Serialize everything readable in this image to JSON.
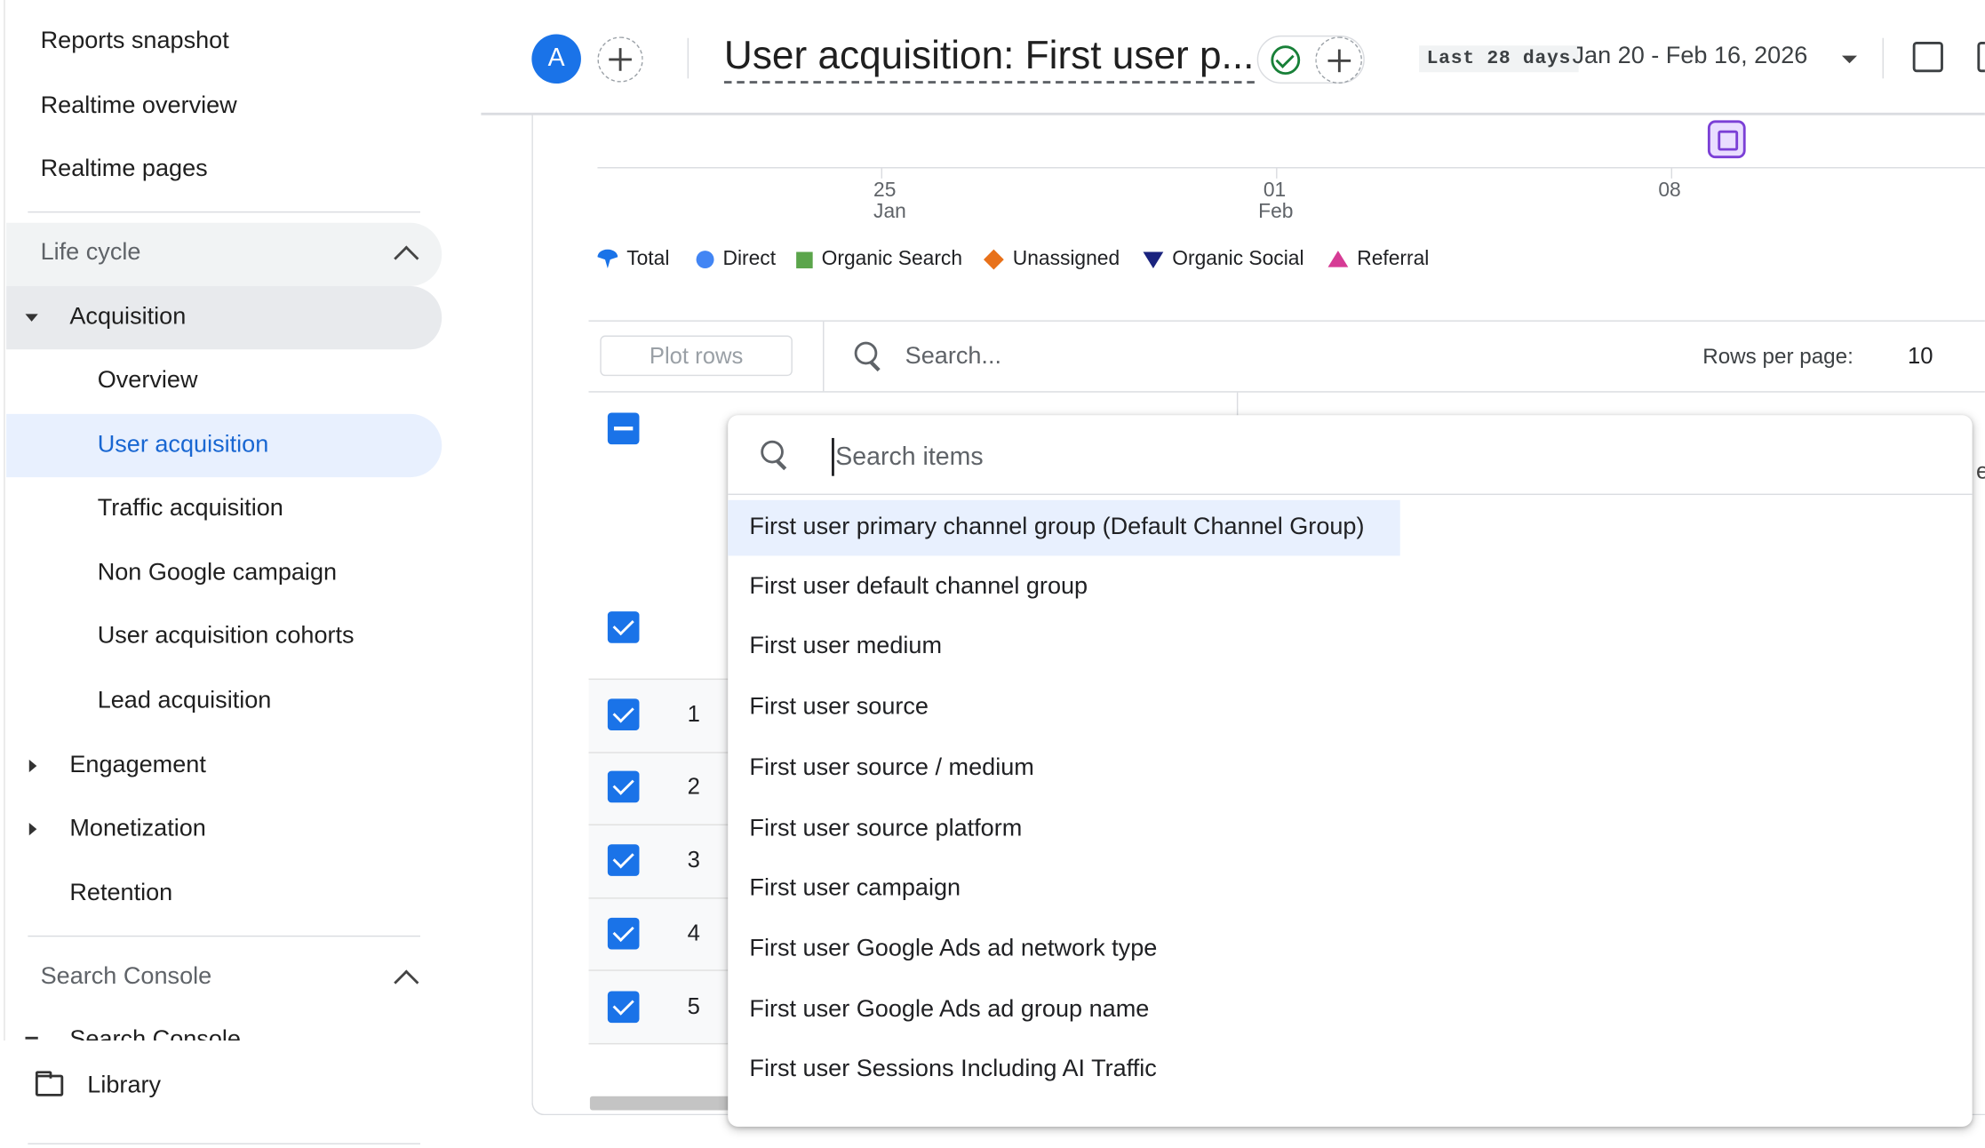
{
  "sidebar": {
    "top_items": [
      "Reports snapshot",
      "Realtime overview",
      "Realtime pages"
    ],
    "lifecycle_label": "Life cycle",
    "acquisition_label": "Acquisition",
    "acquisition_items": [
      "Overview",
      "User acquisition",
      "Traffic acquisition",
      "Non Google campaign",
      "User acquisition cohorts",
      "Lead acquisition"
    ],
    "other_sections": [
      "Engagement",
      "Monetization",
      "Retention"
    ],
    "search_console_label": "Search Console",
    "search_console_child": "Search Console",
    "library_label": "Library",
    "selected_item": "User acquisition"
  },
  "header": {
    "avatar_letter": "A",
    "title": "User acquisition: First user p...",
    "date_chip": "Last 28 days",
    "date_range": "Jan 20 - Feb 16, 2026"
  },
  "chart": {
    "ticks": [
      {
        "day": "25",
        "month": "Jan"
      },
      {
        "day": "01",
        "month": "Feb"
      },
      {
        "day": "08",
        "month": ""
      }
    ],
    "legend": [
      {
        "name": "Total",
        "color": "#1a73e8",
        "shape": "drop"
      },
      {
        "name": "Direct",
        "color": "#4285f4",
        "shape": "circle"
      },
      {
        "name": "Organic Search",
        "color": "#5ba54b",
        "shape": "square"
      },
      {
        "name": "Unassigned",
        "color": "#e8711a",
        "shape": "diamond"
      },
      {
        "name": "Organic Social",
        "color": "#1a237e",
        "shape": "triangle-down"
      },
      {
        "name": "Referral",
        "color": "#d63b95",
        "shape": "triangle-up"
      }
    ]
  },
  "table": {
    "plot_rows_label": "Plot rows",
    "search_placeholder": "Search...",
    "rows_per_page_label": "Rows per page:",
    "rows_per_page_value": "10",
    "row_numbers": [
      "1",
      "2",
      "3",
      "4",
      "5"
    ],
    "partial_header_letter": "e"
  },
  "dropdown": {
    "search_placeholder": "Search items",
    "items": [
      "First user primary channel group (Default Channel Group)",
      "First user default channel group",
      "First user medium",
      "First user source",
      "First user source / medium",
      "First user source platform",
      "First user campaign",
      "First user Google Ads ad network type",
      "First user Google Ads ad group name",
      "First user Sessions Including AI Traffic"
    ],
    "highlighted_index": 0
  }
}
